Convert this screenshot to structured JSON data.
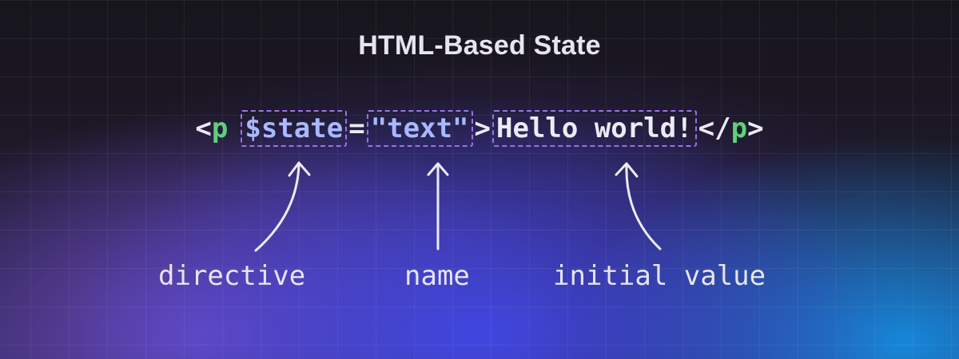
{
  "title": "HTML-Based State",
  "code": {
    "open_bracket": "<",
    "tag": "p",
    "directive": "$state",
    "equals": "=",
    "value": "\"text\"",
    "close_bracket": ">",
    "content": "Hello world!",
    "end_open": "</",
    "end_tag": "p",
    "end_close": ">"
  },
  "labels": {
    "directive": "directive",
    "name": "name",
    "initial_value": "initial value"
  },
  "colors": {
    "tag": "#5fd07a",
    "attribute": "#a9b8ff",
    "highlight_border": "#9a72ea",
    "text": "#ecebf3"
  }
}
